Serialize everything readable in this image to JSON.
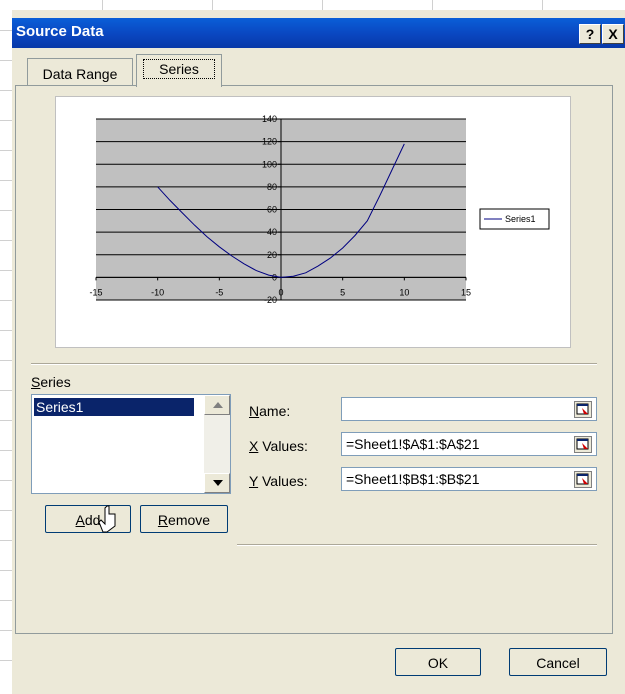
{
  "dialog": {
    "title": "Source Data",
    "help_label": "?",
    "close_label": "X"
  },
  "tabs": [
    {
      "label": "Data Range",
      "active": false
    },
    {
      "label": "Series",
      "active": true
    }
  ],
  "chart_data": {
    "type": "line",
    "x": [
      -10,
      -9,
      -8,
      -7,
      -6,
      -5,
      -4,
      -3,
      -2,
      -1,
      0,
      1,
      2,
      3,
      4,
      5,
      6,
      7,
      8,
      9,
      10
    ],
    "series": [
      {
        "name": "Series1",
        "values": [
          80,
          68,
          57,
          46,
          36,
          27,
          19,
          12,
          6,
          2,
          0,
          1,
          4,
          10,
          17,
          26,
          37,
          50,
          72,
          95,
          118
        ]
      }
    ],
    "xlim": [
      -15,
      15
    ],
    "ylim": [
      -20,
      140
    ],
    "xticks": [
      "-15",
      "-10",
      "-5",
      "0",
      "5",
      "10",
      "15"
    ],
    "yticks": [
      "-20",
      "0",
      "20",
      "40",
      "60",
      "80",
      "100",
      "120",
      "140"
    ],
    "legend_position": "right",
    "grid": true,
    "plot_bg": "#c0c0c0",
    "line_color": "#000080"
  },
  "series_section": {
    "label_prefix": "",
    "label_access": "S",
    "label_rest": "eries",
    "items": [
      "Series1"
    ],
    "add_access": "A",
    "add_rest": "dd",
    "remove_access": "R",
    "remove_rest": "emove"
  },
  "fields": {
    "name": {
      "label_access": "N",
      "label_rest": "ame:",
      "value": ""
    },
    "x_values": {
      "label_access": "X",
      "label_rest": " Values:",
      "value": "=Sheet1!$A$1:$A$21"
    },
    "y_values": {
      "label_access": "Y",
      "label_rest": " Values:",
      "value": "=Sheet1!$B$1:$B$21"
    }
  },
  "footer": {
    "ok_label": "OK",
    "cancel_label": "Cancel"
  }
}
